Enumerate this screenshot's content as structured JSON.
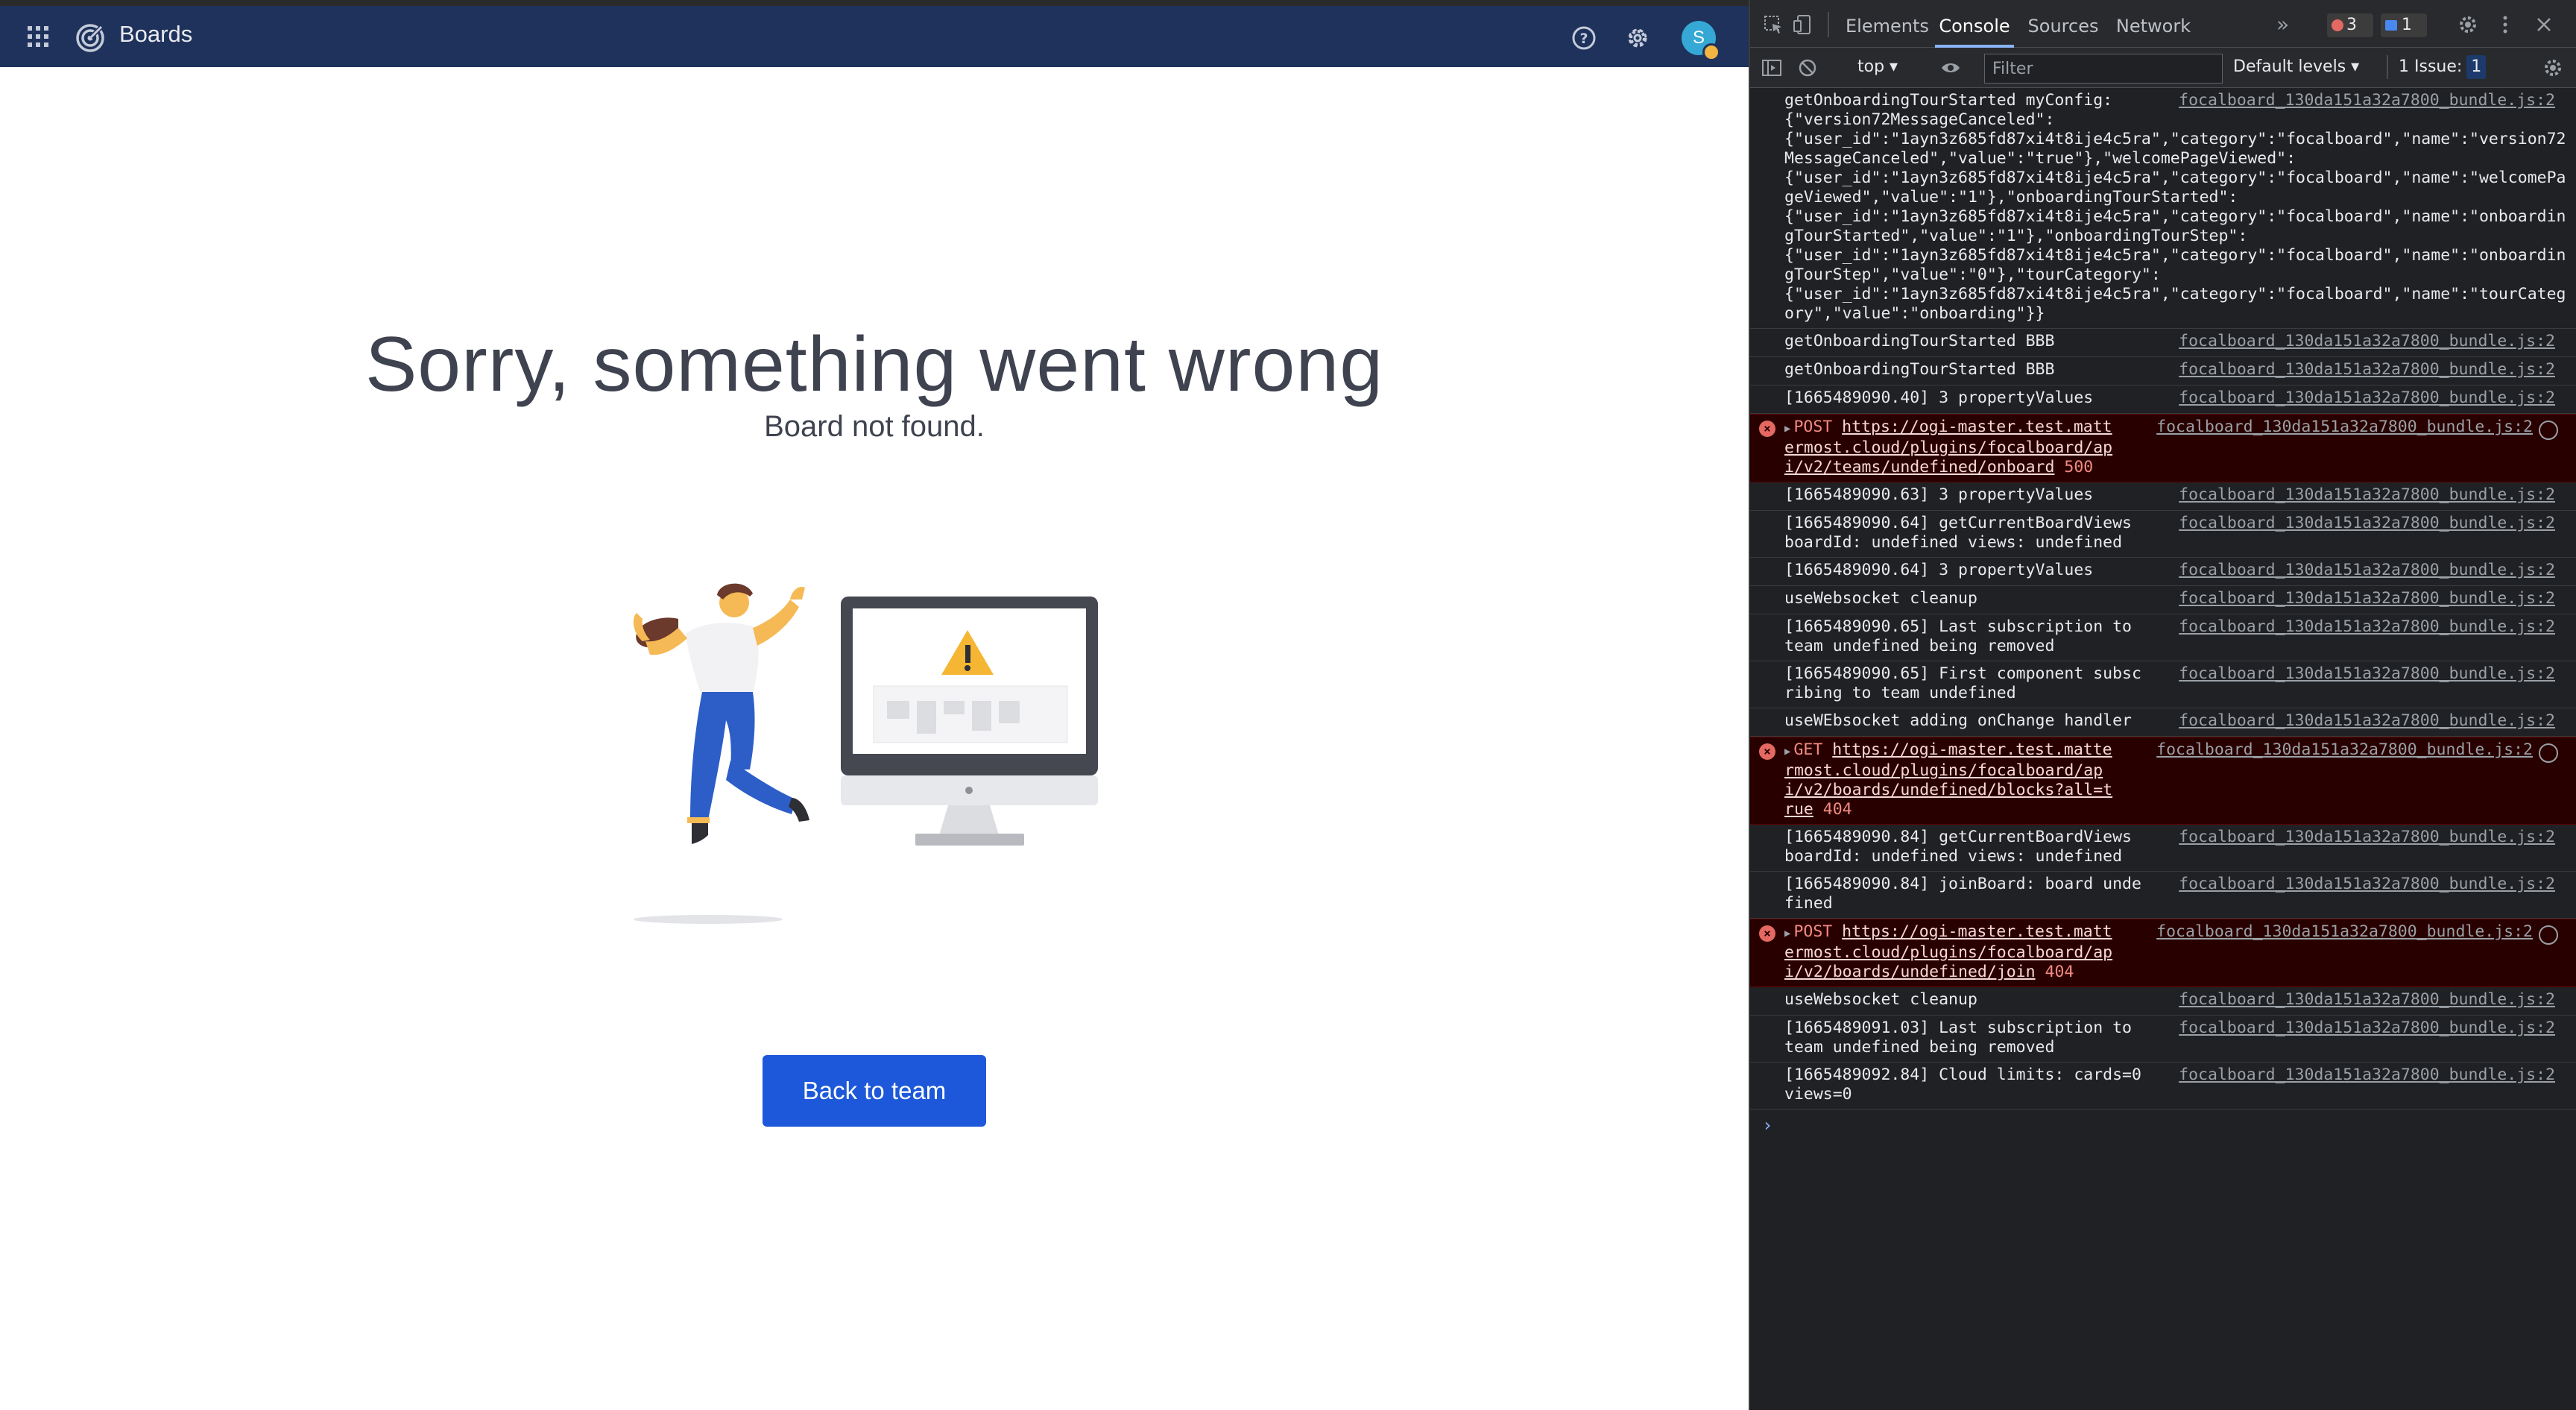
{
  "app": {
    "title": "Boards",
    "avatar_initial": "S",
    "error_heading": "Sorry, something went wrong",
    "error_subtitle": "Board not found.",
    "back_button_label": "Back to team",
    "colors": {
      "topbar": "#1e325c",
      "button": "#1c58d9",
      "heading": "#3f4350"
    },
    "icons": [
      "grid-icon",
      "boards-logo-icon",
      "help-icon",
      "gear-icon"
    ]
  },
  "devtools": {
    "tabs": [
      "Elements",
      "Console",
      "Sources",
      "Network"
    ],
    "active_tab": "Console",
    "more_tabs": "»",
    "error_count": "3",
    "message_count": "1",
    "context": "top ▾",
    "filter_placeholder": "Filter",
    "levels": "Default levels ▾",
    "issues_label": "1 Issue:",
    "issues_count": "1",
    "source": "focalboard_130da151a32a7800_bundle.js:2",
    "logs": [
      {
        "msg": "getOnboardingTourStarted myConfig:"
      },
      {
        "msg": "{\"version72MessageCanceled\":\n{\"user_id\":\"1ayn3z685fd87xi4t8ije4c5ra\",\"category\":\"focalboard\",\"name\":\"version72MessageCanceled\",\"value\":\"true\"},\"welcomePageViewed\":\n{\"user_id\":\"1ayn3z685fd87xi4t8ije4c5ra\",\"category\":\"focalboard\",\"name\":\"welcomePageViewed\",\"value\":\"1\"},\"onboardingTourStarted\":\n{\"user_id\":\"1ayn3z685fd87xi4t8ije4c5ra\",\"category\":\"focalboard\",\"name\":\"onboardingTourStarted\",\"value\":\"1\"},\"onboardingTourStep\":\n{\"user_id\":\"1ayn3z685fd87xi4t8ije4c5ra\",\"category\":\"focalboard\",\"name\":\"onboardingTourStep\",\"value\":\"0\"},\"tourCategory\":\n{\"user_id\":\"1ayn3z685fd87xi4t8ije4c5ra\",\"category\":\"focalboard\",\"name\":\"tourCategory\",\"value\":\"onboarding\"}}"
      },
      {
        "msg": "getOnboardingTourStarted BBB"
      },
      {
        "msg": "getOnboardingTourStarted BBB"
      },
      {
        "msg": "[1665489090.40] 3 propertyValues"
      },
      {
        "method": "POST",
        "url": "https://ogi-master.test.mattermost.cloud/plugins/focalboard/api/v2/teams/undefined/onboard",
        "status": "500"
      },
      {
        "msg": "[1665489090.63] 3 propertyValues"
      },
      {
        "msg": "[1665489090.64] getCurrentBoardViews boardId: undefined views: undefined"
      },
      {
        "msg": "[1665489090.64] 3 propertyValues"
      },
      {
        "msg": "useWebsocket cleanup"
      },
      {
        "msg": "[1665489090.65] Last subscription to team undefined being removed"
      },
      {
        "msg": "[1665489090.65] First component subscribing to team undefined"
      },
      {
        "msg": "useWEbsocket adding onChange handler"
      },
      {
        "method": "GET",
        "url": "https://ogi-master.test.mattermost.cloud/plugins/focalboard/api/v2/boards/undefined/blocks?all=true",
        "status": "404"
      },
      {
        "msg": "[1665489090.84] getCurrentBoardViews boardId: undefined views: undefined"
      },
      {
        "msg": "[1665489090.84] joinBoard: board undefined"
      },
      {
        "method": "POST",
        "url": "https://ogi-master.test.mattermost.cloud/plugins/focalboard/api/v2/boards/undefined/join",
        "status": "404"
      },
      {
        "msg": "useWebsocket cleanup"
      },
      {
        "msg": "[1665489091.03] Last subscription to team undefined being removed"
      },
      {
        "msg": "[1665489092.84] Cloud limits: cards=0   views=0"
      }
    ],
    "prompt": "›"
  }
}
